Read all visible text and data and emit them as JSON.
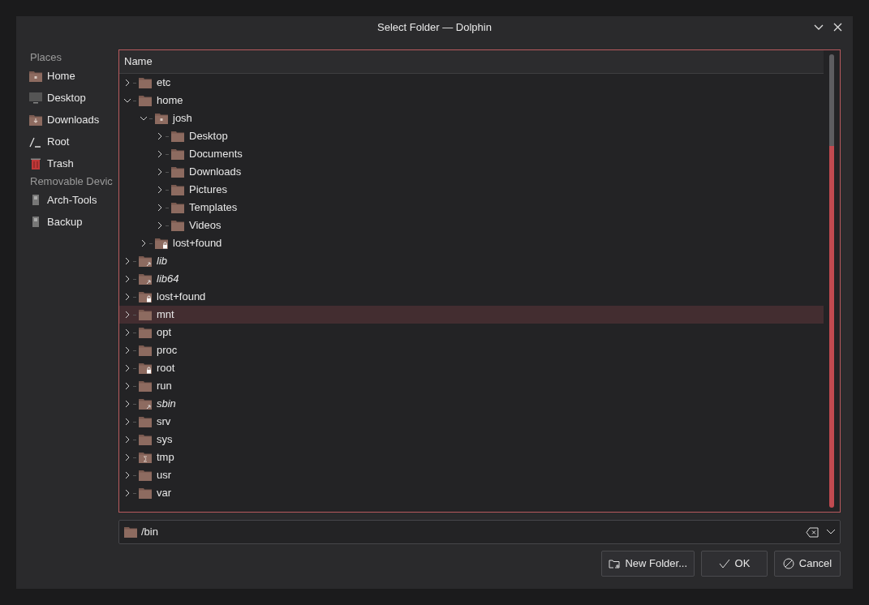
{
  "window": {
    "title": "Select Folder — Dolphin"
  },
  "sidebar": {
    "sections": [
      {
        "heading": "Places",
        "items": [
          {
            "label": "Home",
            "kind": "home"
          },
          {
            "label": "Desktop",
            "kind": "desktop"
          },
          {
            "label": "Downloads",
            "kind": "downloads"
          },
          {
            "label": "Root",
            "kind": "root"
          },
          {
            "label": "Trash",
            "kind": "trash"
          }
        ]
      },
      {
        "heading": "Removable Devic",
        "items": [
          {
            "label": "Arch-Tools",
            "kind": "drive"
          },
          {
            "label": "Backup",
            "kind": "drive"
          }
        ]
      }
    ]
  },
  "tree": {
    "columns": [
      "Name"
    ],
    "items": [
      {
        "name": "etc",
        "kind": "folder",
        "expanded": false,
        "hovered": false
      },
      {
        "name": "home",
        "kind": "folder",
        "expanded": true,
        "hovered": false,
        "children": [
          {
            "name": "josh",
            "kind": "home",
            "expanded": true,
            "hovered": false,
            "children": [
              {
                "name": "Desktop",
                "kind": "folder",
                "expanded": false,
                "hovered": false
              },
              {
                "name": "Documents",
                "kind": "folder",
                "expanded": false,
                "hovered": false
              },
              {
                "name": "Downloads",
                "kind": "folder",
                "expanded": false,
                "hovered": false
              },
              {
                "name": "Pictures",
                "kind": "folder",
                "expanded": false,
                "hovered": false
              },
              {
                "name": "Templates",
                "kind": "folder",
                "expanded": false,
                "hovered": false
              },
              {
                "name": "Videos",
                "kind": "folder",
                "expanded": false,
                "hovered": false
              }
            ]
          },
          {
            "name": "lost+found",
            "kind": "locked",
            "expanded": false,
            "hovered": false
          }
        ]
      },
      {
        "name": "lib",
        "kind": "symlink",
        "expanded": false,
        "hovered": false
      },
      {
        "name": "lib64",
        "kind": "symlink",
        "expanded": false,
        "hovered": false
      },
      {
        "name": "lost+found",
        "kind": "locked",
        "expanded": false,
        "hovered": false
      },
      {
        "name": "mnt",
        "kind": "folder",
        "expanded": false,
        "hovered": true
      },
      {
        "name": "opt",
        "kind": "folder",
        "expanded": false,
        "hovered": false
      },
      {
        "name": "proc",
        "kind": "folder",
        "expanded": false,
        "hovered": false
      },
      {
        "name": "root",
        "kind": "locked",
        "expanded": false,
        "hovered": false
      },
      {
        "name": "run",
        "kind": "folder",
        "expanded": false,
        "hovered": false
      },
      {
        "name": "sbin",
        "kind": "symlink",
        "expanded": false,
        "hovered": false
      },
      {
        "name": "srv",
        "kind": "folder",
        "expanded": false,
        "hovered": false
      },
      {
        "name": "sys",
        "kind": "folder",
        "expanded": false,
        "hovered": false
      },
      {
        "name": "tmp",
        "kind": "temp",
        "expanded": false,
        "hovered": false
      },
      {
        "name": "usr",
        "kind": "folder",
        "expanded": false,
        "hovered": false
      },
      {
        "name": "var",
        "kind": "folder",
        "expanded": false,
        "hovered": false
      }
    ]
  },
  "path_field": {
    "value": "/bin"
  },
  "buttons": [
    {
      "label": "New Folder...",
      "kind": "new-folder"
    },
    {
      "label": "OK",
      "kind": "ok"
    },
    {
      "label": "Cancel",
      "kind": "cancel"
    }
  ]
}
